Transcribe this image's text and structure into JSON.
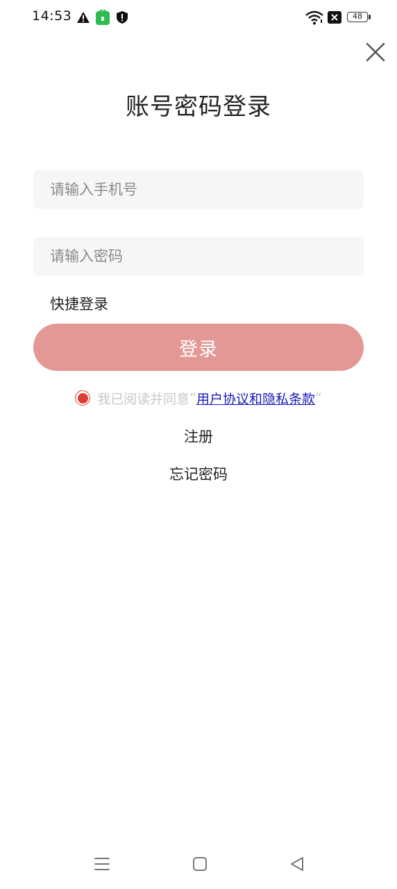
{
  "status_bar": {
    "time": "14:53",
    "battery": "48",
    "icons": [
      "warning-icon",
      "green-app-icon",
      "shield-icon",
      "wifi-icon",
      "close-box-icon",
      "battery-icon"
    ]
  },
  "header": {
    "title": "账号密码登录",
    "close_icon": "close-icon"
  },
  "form": {
    "phone_placeholder": "请输入手机号",
    "phone_value": "",
    "password_placeholder": "请输入密码",
    "password_value": "",
    "quick_login_label": "快捷登录",
    "login_button_label": "登录"
  },
  "agreement": {
    "prefix": "我已阅读并同意",
    "open_quote": "“",
    "link_text": "用户协议和隐私条款",
    "close_quote": "”",
    "checked": true
  },
  "links": {
    "register": "注册",
    "forgot_password": "忘记密码"
  },
  "colors": {
    "login_button": "#e49895",
    "radio_accent": "#e23b33",
    "link": "#1a1ab8",
    "input_bg": "#f6f6f6"
  },
  "nav_bar": {
    "icons": [
      "menu-icon",
      "home-icon",
      "back-icon"
    ]
  }
}
